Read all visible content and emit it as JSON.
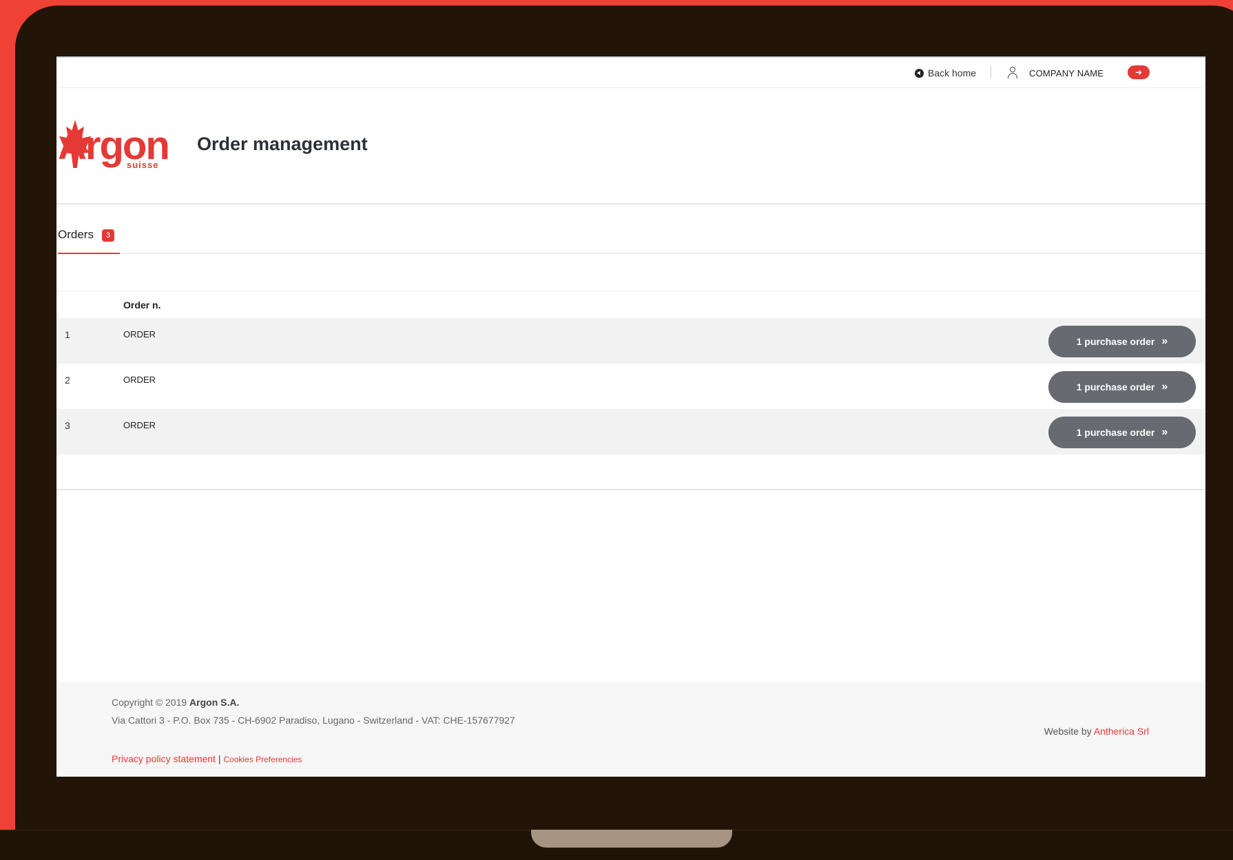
{
  "topbar": {
    "back_home": "Back home",
    "company_name": "COMPANY NAME",
    "logout_icon": "sign-out-icon"
  },
  "logo": {
    "word": "Argon",
    "sub": "suisse"
  },
  "header": {
    "title": "Order management"
  },
  "tabs": [
    {
      "label": "Orders",
      "badge": "3"
    }
  ],
  "table": {
    "columns": [
      "",
      "Order n."
    ],
    "rows": [
      {
        "num": "1",
        "order": "ORDER",
        "action": "1 purchase order"
      },
      {
        "num": "2",
        "order": "ORDER",
        "action": "1 purchase order"
      },
      {
        "num": "3",
        "order": "ORDER",
        "action": "1 purchase order"
      }
    ]
  },
  "footer": {
    "copyright": "Copyright © 2019",
    "company": "Argon S.A.",
    "address": "Via Cattori 3 - P.O. Box 735 - CH-6902 Paradiso, Lugano - Switzerland - VAT: CHE-157677927",
    "privacy": "Privacy policy statement",
    "separator": "|",
    "cookies": "Cookies Preferencies",
    "website_by": "Website by",
    "agency": "Antherica Srl"
  },
  "colors": {
    "accent": "#e53935",
    "button": "#676a70",
    "frame": "#221507",
    "background": "#ef4136"
  }
}
